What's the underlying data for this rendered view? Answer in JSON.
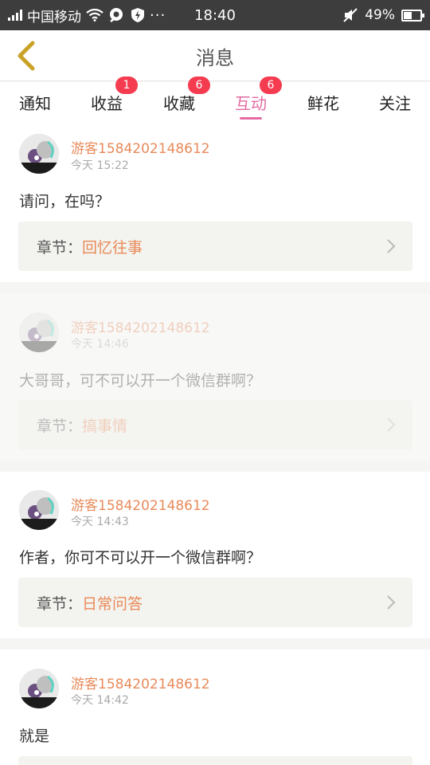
{
  "status": {
    "carrier": "中国移动",
    "time": "18:40",
    "battery": "49%",
    "battery_level": 0.49,
    "icons": [
      "signal-icon",
      "wifi-icon",
      "notification-icon",
      "shield-icon",
      "more-icon",
      "mute-icon",
      "battery-icon"
    ]
  },
  "header": {
    "title": "消息",
    "back_icon": "chevron-left-icon"
  },
  "tabs": [
    {
      "label": "通知",
      "badge": ""
    },
    {
      "label": "收益",
      "badge": "1"
    },
    {
      "label": "收藏",
      "badge": "6"
    },
    {
      "label": "互动",
      "badge": "6",
      "active": true
    },
    {
      "label": "鲜花",
      "badge": ""
    },
    {
      "label": "关注",
      "badge": ""
    }
  ],
  "chapter_prefix": "章节：",
  "messages": [
    {
      "user": "游客1584202148612",
      "time": "今天 15:22",
      "text": "请问，在吗？",
      "chapter": "回忆往事",
      "faded": false
    },
    {
      "user": "游客1584202148612",
      "time": "今天 14:46",
      "text": "大哥哥，可不可以开一个微信群啊？",
      "chapter": "搞事情",
      "faded": true
    },
    {
      "user": "游客1584202148612",
      "time": "今天 14:43",
      "text": "作者，你可不可以开一个微信群啊？",
      "chapter": "日常问答",
      "faded": false
    },
    {
      "user": "游客1584202148612",
      "time": "今天 14:42",
      "text": "就是",
      "chapter": "",
      "faded": false
    }
  ],
  "colors": {
    "accent_pink": "#e46aa3",
    "badge_red": "#f53b50",
    "username_orange": "#e88a5a",
    "back_arrow": "#c9a227"
  }
}
